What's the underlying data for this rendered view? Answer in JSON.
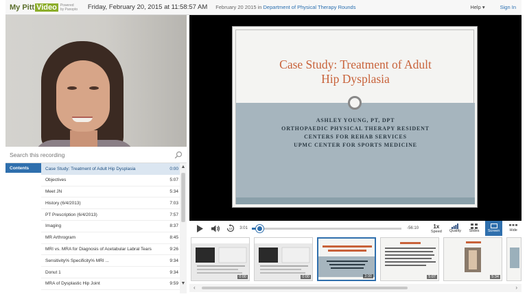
{
  "header": {
    "logo_my": "My Pitt",
    "logo_video": "Video",
    "logo_powered": "Powered by Panopto",
    "session_title": "Friday, February 20, 2015 at 11:58:57 AM",
    "session_date": "February 20 2015 in",
    "folder_link": "Department of Physical Therapy Rounds",
    "help_label": "Help",
    "signin_label": "Sign In"
  },
  "search": {
    "placeholder": "Search this recording"
  },
  "contents": {
    "tab_label": "Contents",
    "items": [
      {
        "title": "Case Study: Treatment of Adult Hip Dysplasia",
        "time": "0:00"
      },
      {
        "title": "Objectives",
        "time": "5:07"
      },
      {
        "title": "Meet JN",
        "time": "5:34"
      },
      {
        "title": "History (6/4/2013)",
        "time": "7:03"
      },
      {
        "title": "PT Prescription (6/4/2013)",
        "time": "7:57"
      },
      {
        "title": "Imaging",
        "time": "8:37"
      },
      {
        "title": "MR Arthrogram",
        "time": "8:45"
      },
      {
        "title": "MRI vs. MRA for Diagnosis of Acetabular Labral Tears",
        "time": "9:26"
      },
      {
        "title": "Sensitivity% Specificity% MRI ...",
        "time": "9:34"
      },
      {
        "title": "Donut 1",
        "time": "9:34"
      },
      {
        "title": "MRA of Dysplastic Hip Joint",
        "time": "9:59"
      }
    ]
  },
  "slide": {
    "title_line1": "Case Study: Treatment of Adult",
    "title_line2": "Hip Dysplasia",
    "sub_line1": "Ashley Young, PT, DPT",
    "sub_line2": "Orthopaedic Physical Therapy Resident",
    "sub_line3": "Centers for Rehab Services",
    "sub_line4": "UPMC Center for Sports Medicine"
  },
  "controls": {
    "current_time": "3:01",
    "remaining_time": "-56:10",
    "progress_fraction": 0.05,
    "speed_value": "1x",
    "speed_label": "Speed",
    "quality_label": "Quality",
    "slides_label": "Slides",
    "screen_label": "Screen",
    "hide_label": "Hide"
  },
  "thumbnails": [
    {
      "time": "0:00"
    },
    {
      "time": "0:00"
    },
    {
      "time": "3:00"
    },
    {
      "time": "5:07"
    },
    {
      "time": "5:34"
    }
  ],
  "colors": {
    "accent": "#2f6fad",
    "slide_title": "#c8623a",
    "slide_band": "#a6b5be"
  }
}
